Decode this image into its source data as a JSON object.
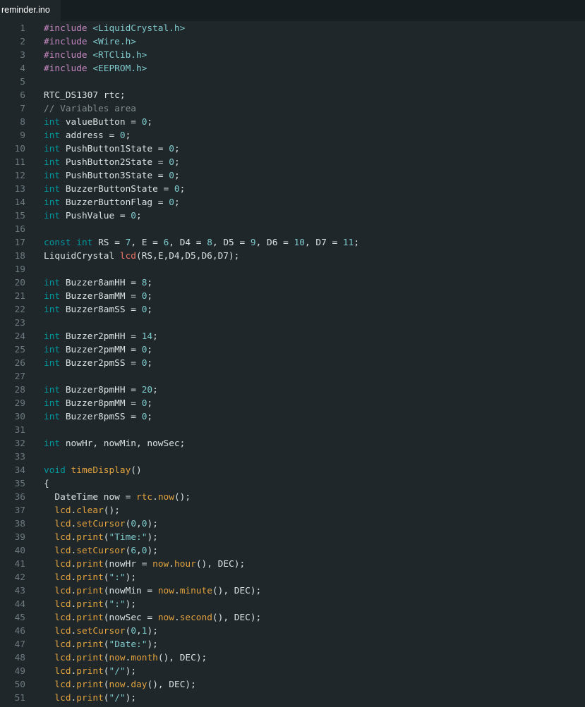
{
  "tab": {
    "filename": "reminder.ino"
  },
  "colors": {
    "background": "#1f272a",
    "line_numbers": "#6c7a80",
    "text": "#dae3e3",
    "keyword": "#00979c",
    "directive": "#c586c0",
    "string": "#7fcbcd",
    "function": "#e97366",
    "method": "#e1a23e",
    "comment": "#7f8c8d"
  },
  "lines": [
    {
      "n": "1",
      "tokens": [
        [
          "dir",
          "#include "
        ],
        [
          "str",
          "<LiquidCrystal.h>"
        ]
      ]
    },
    {
      "n": "2",
      "tokens": [
        [
          "dir",
          "#include "
        ],
        [
          "str",
          "<Wire.h>"
        ]
      ]
    },
    {
      "n": "3",
      "tokens": [
        [
          "dir",
          "#include "
        ],
        [
          "str",
          "<RTClib.h>"
        ]
      ]
    },
    {
      "n": "4",
      "tokens": [
        [
          "dir",
          "#include "
        ],
        [
          "str",
          "<EEPROM.h>"
        ]
      ]
    },
    {
      "n": "5",
      "tokens": []
    },
    {
      "n": "6",
      "tokens": [
        [
          "plain",
          "RTC_DS1307 rtc;"
        ]
      ]
    },
    {
      "n": "7",
      "tokens": [
        [
          "cmt",
          "// Variables area"
        ]
      ]
    },
    {
      "n": "8",
      "tokens": [
        [
          "kw",
          "int"
        ],
        [
          "plain",
          " valueButton = "
        ],
        [
          "num",
          "0"
        ],
        [
          "plain",
          ";"
        ]
      ]
    },
    {
      "n": "9",
      "tokens": [
        [
          "kw",
          "int"
        ],
        [
          "plain",
          " address = "
        ],
        [
          "num",
          "0"
        ],
        [
          "plain",
          ";"
        ]
      ]
    },
    {
      "n": "10",
      "tokens": [
        [
          "kw",
          "int"
        ],
        [
          "plain",
          " PushButton1State = "
        ],
        [
          "num",
          "0"
        ],
        [
          "plain",
          ";"
        ]
      ]
    },
    {
      "n": "11",
      "tokens": [
        [
          "kw",
          "int"
        ],
        [
          "plain",
          " PushButton2State = "
        ],
        [
          "num",
          "0"
        ],
        [
          "plain",
          ";"
        ]
      ]
    },
    {
      "n": "12",
      "tokens": [
        [
          "kw",
          "int"
        ],
        [
          "plain",
          " PushButton3State = "
        ],
        [
          "num",
          "0"
        ],
        [
          "plain",
          ";"
        ]
      ]
    },
    {
      "n": "13",
      "tokens": [
        [
          "kw",
          "int"
        ],
        [
          "plain",
          " BuzzerButtonState = "
        ],
        [
          "num",
          "0"
        ],
        [
          "plain",
          ";"
        ]
      ]
    },
    {
      "n": "14",
      "tokens": [
        [
          "kw",
          "int"
        ],
        [
          "plain",
          " BuzzerButtonFlag = "
        ],
        [
          "num",
          "0"
        ],
        [
          "plain",
          ";"
        ]
      ]
    },
    {
      "n": "15",
      "tokens": [
        [
          "kw",
          "int"
        ],
        [
          "plain",
          " PushValue = "
        ],
        [
          "num",
          "0"
        ],
        [
          "plain",
          ";"
        ]
      ]
    },
    {
      "n": "16",
      "tokens": []
    },
    {
      "n": "17",
      "tokens": [
        [
          "kw",
          "const"
        ],
        [
          "plain",
          " "
        ],
        [
          "kw",
          "int"
        ],
        [
          "plain",
          " RS = "
        ],
        [
          "num",
          "7"
        ],
        [
          "plain",
          ", E = "
        ],
        [
          "num",
          "6"
        ],
        [
          "plain",
          ", D4 = "
        ],
        [
          "num",
          "8"
        ],
        [
          "plain",
          ", D5 = "
        ],
        [
          "num",
          "9"
        ],
        [
          "plain",
          ", D6 = "
        ],
        [
          "num",
          "10"
        ],
        [
          "plain",
          ", D7 = "
        ],
        [
          "num",
          "11"
        ],
        [
          "plain",
          ";"
        ]
      ]
    },
    {
      "n": "18",
      "tokens": [
        [
          "plain",
          "LiquidCrystal "
        ],
        [
          "fn",
          "lcd"
        ],
        [
          "plain",
          "(RS,E,D4,D5,D6,D7);"
        ]
      ]
    },
    {
      "n": "19",
      "tokens": []
    },
    {
      "n": "20",
      "tokens": [
        [
          "kw",
          "int"
        ],
        [
          "plain",
          " Buzzer8amHH = "
        ],
        [
          "num",
          "8"
        ],
        [
          "plain",
          ";"
        ]
      ]
    },
    {
      "n": "21",
      "tokens": [
        [
          "kw",
          "int"
        ],
        [
          "plain",
          " Buzzer8amMM = "
        ],
        [
          "num",
          "0"
        ],
        [
          "plain",
          ";"
        ]
      ]
    },
    {
      "n": "22",
      "tokens": [
        [
          "kw",
          "int"
        ],
        [
          "plain",
          " Buzzer8amSS = "
        ],
        [
          "num",
          "0"
        ],
        [
          "plain",
          ";"
        ]
      ]
    },
    {
      "n": "23",
      "tokens": []
    },
    {
      "n": "24",
      "tokens": [
        [
          "kw",
          "int"
        ],
        [
          "plain",
          " Buzzer2pmHH = "
        ],
        [
          "num",
          "14"
        ],
        [
          "plain",
          ";"
        ]
      ]
    },
    {
      "n": "25",
      "tokens": [
        [
          "kw",
          "int"
        ],
        [
          "plain",
          " Buzzer2pmMM = "
        ],
        [
          "num",
          "0"
        ],
        [
          "plain",
          ";"
        ]
      ]
    },
    {
      "n": "26",
      "tokens": [
        [
          "kw",
          "int"
        ],
        [
          "plain",
          " Buzzer2pmSS = "
        ],
        [
          "num",
          "0"
        ],
        [
          "plain",
          ";"
        ]
      ]
    },
    {
      "n": "27",
      "tokens": []
    },
    {
      "n": "28",
      "tokens": [
        [
          "kw",
          "int"
        ],
        [
          "plain",
          " Buzzer8pmHH = "
        ],
        [
          "num",
          "20"
        ],
        [
          "plain",
          ";"
        ]
      ]
    },
    {
      "n": "29",
      "tokens": [
        [
          "kw",
          "int"
        ],
        [
          "plain",
          " Buzzer8pmMM = "
        ],
        [
          "num",
          "0"
        ],
        [
          "plain",
          ";"
        ]
      ]
    },
    {
      "n": "30",
      "tokens": [
        [
          "kw",
          "int"
        ],
        [
          "plain",
          " Buzzer8pmSS = "
        ],
        [
          "num",
          "0"
        ],
        [
          "plain",
          ";"
        ]
      ]
    },
    {
      "n": "31",
      "tokens": []
    },
    {
      "n": "32",
      "tokens": [
        [
          "kw",
          "int"
        ],
        [
          "plain",
          " nowHr, nowMin, nowSec;"
        ]
      ]
    },
    {
      "n": "33",
      "tokens": []
    },
    {
      "n": "34",
      "tokens": [
        [
          "kw",
          "void"
        ],
        [
          "plain",
          " "
        ],
        [
          "mth",
          "timeDisplay"
        ],
        [
          "plain",
          "()"
        ]
      ]
    },
    {
      "n": "35",
      "tokens": [
        [
          "plain",
          "{"
        ]
      ]
    },
    {
      "n": "36",
      "tokens": [
        [
          "plain",
          "  DateTime now = "
        ],
        [
          "mth",
          "rtc"
        ],
        [
          "plain",
          "."
        ],
        [
          "mth",
          "now"
        ],
        [
          "plain",
          "();"
        ]
      ]
    },
    {
      "n": "37",
      "tokens": [
        [
          "plain",
          "  "
        ],
        [
          "mth",
          "lcd"
        ],
        [
          "plain",
          "."
        ],
        [
          "mth",
          "clear"
        ],
        [
          "plain",
          "();"
        ]
      ]
    },
    {
      "n": "38",
      "tokens": [
        [
          "plain",
          "  "
        ],
        [
          "mth",
          "lcd"
        ],
        [
          "plain",
          "."
        ],
        [
          "mth",
          "setCursor"
        ],
        [
          "plain",
          "("
        ],
        [
          "num",
          "0"
        ],
        [
          "plain",
          ","
        ],
        [
          "num",
          "0"
        ],
        [
          "plain",
          ");"
        ]
      ]
    },
    {
      "n": "39",
      "tokens": [
        [
          "plain",
          "  "
        ],
        [
          "mth",
          "lcd"
        ],
        [
          "plain",
          "."
        ],
        [
          "mth",
          "print"
        ],
        [
          "plain",
          "("
        ],
        [
          "str",
          "\"Time:\""
        ],
        [
          "plain",
          ");"
        ]
      ]
    },
    {
      "n": "40",
      "tokens": [
        [
          "plain",
          "  "
        ],
        [
          "mth",
          "lcd"
        ],
        [
          "plain",
          "."
        ],
        [
          "mth",
          "setCursor"
        ],
        [
          "plain",
          "("
        ],
        [
          "num",
          "6"
        ],
        [
          "plain",
          ","
        ],
        [
          "num",
          "0"
        ],
        [
          "plain",
          ");"
        ]
      ]
    },
    {
      "n": "41",
      "tokens": [
        [
          "plain",
          "  "
        ],
        [
          "mth",
          "lcd"
        ],
        [
          "plain",
          "."
        ],
        [
          "mth",
          "print"
        ],
        [
          "plain",
          "(nowHr = "
        ],
        [
          "mth",
          "now"
        ],
        [
          "plain",
          "."
        ],
        [
          "mth",
          "hour"
        ],
        [
          "plain",
          "(), DEC);"
        ]
      ]
    },
    {
      "n": "42",
      "tokens": [
        [
          "plain",
          "  "
        ],
        [
          "mth",
          "lcd"
        ],
        [
          "plain",
          "."
        ],
        [
          "mth",
          "print"
        ],
        [
          "plain",
          "("
        ],
        [
          "str",
          "\":\""
        ],
        [
          "plain",
          ");"
        ]
      ]
    },
    {
      "n": "43",
      "tokens": [
        [
          "plain",
          "  "
        ],
        [
          "mth",
          "lcd"
        ],
        [
          "plain",
          "."
        ],
        [
          "mth",
          "print"
        ],
        [
          "plain",
          "(nowMin = "
        ],
        [
          "mth",
          "now"
        ],
        [
          "plain",
          "."
        ],
        [
          "mth",
          "minute"
        ],
        [
          "plain",
          "(), DEC);"
        ]
      ]
    },
    {
      "n": "44",
      "tokens": [
        [
          "plain",
          "  "
        ],
        [
          "mth",
          "lcd"
        ],
        [
          "plain",
          "."
        ],
        [
          "mth",
          "print"
        ],
        [
          "plain",
          "("
        ],
        [
          "str",
          "\":\""
        ],
        [
          "plain",
          ");"
        ]
      ]
    },
    {
      "n": "45",
      "tokens": [
        [
          "plain",
          "  "
        ],
        [
          "mth",
          "lcd"
        ],
        [
          "plain",
          "."
        ],
        [
          "mth",
          "print"
        ],
        [
          "plain",
          "(nowSec = "
        ],
        [
          "mth",
          "now"
        ],
        [
          "plain",
          "."
        ],
        [
          "mth",
          "second"
        ],
        [
          "plain",
          "(), DEC);"
        ]
      ]
    },
    {
      "n": "46",
      "tokens": [
        [
          "plain",
          "  "
        ],
        [
          "mth",
          "lcd"
        ],
        [
          "plain",
          "."
        ],
        [
          "mth",
          "setCursor"
        ],
        [
          "plain",
          "("
        ],
        [
          "num",
          "0"
        ],
        [
          "plain",
          ","
        ],
        [
          "num",
          "1"
        ],
        [
          "plain",
          ");"
        ]
      ]
    },
    {
      "n": "47",
      "tokens": [
        [
          "plain",
          "  "
        ],
        [
          "mth",
          "lcd"
        ],
        [
          "plain",
          "."
        ],
        [
          "mth",
          "print"
        ],
        [
          "plain",
          "("
        ],
        [
          "str",
          "\"Date:\""
        ],
        [
          "plain",
          ");"
        ]
      ]
    },
    {
      "n": "48",
      "tokens": [
        [
          "plain",
          "  "
        ],
        [
          "mth",
          "lcd"
        ],
        [
          "plain",
          "."
        ],
        [
          "mth",
          "print"
        ],
        [
          "plain",
          "("
        ],
        [
          "mth",
          "now"
        ],
        [
          "plain",
          "."
        ],
        [
          "mth",
          "month"
        ],
        [
          "plain",
          "(), DEC);"
        ]
      ]
    },
    {
      "n": "49",
      "tokens": [
        [
          "plain",
          "  "
        ],
        [
          "mth",
          "lcd"
        ],
        [
          "plain",
          "."
        ],
        [
          "mth",
          "print"
        ],
        [
          "plain",
          "("
        ],
        [
          "str",
          "\"/\""
        ],
        [
          "plain",
          ");"
        ]
      ]
    },
    {
      "n": "50",
      "tokens": [
        [
          "plain",
          "  "
        ],
        [
          "mth",
          "lcd"
        ],
        [
          "plain",
          "."
        ],
        [
          "mth",
          "print"
        ],
        [
          "plain",
          "("
        ],
        [
          "mth",
          "now"
        ],
        [
          "plain",
          "."
        ],
        [
          "mth",
          "day"
        ],
        [
          "plain",
          "(), DEC);"
        ]
      ]
    },
    {
      "n": "51",
      "tokens": [
        [
          "plain",
          "  "
        ],
        [
          "mth",
          "lcd"
        ],
        [
          "plain",
          "."
        ],
        [
          "mth",
          "print"
        ],
        [
          "plain",
          "("
        ],
        [
          "str",
          "\"/\""
        ],
        [
          "plain",
          ");"
        ]
      ]
    }
  ]
}
